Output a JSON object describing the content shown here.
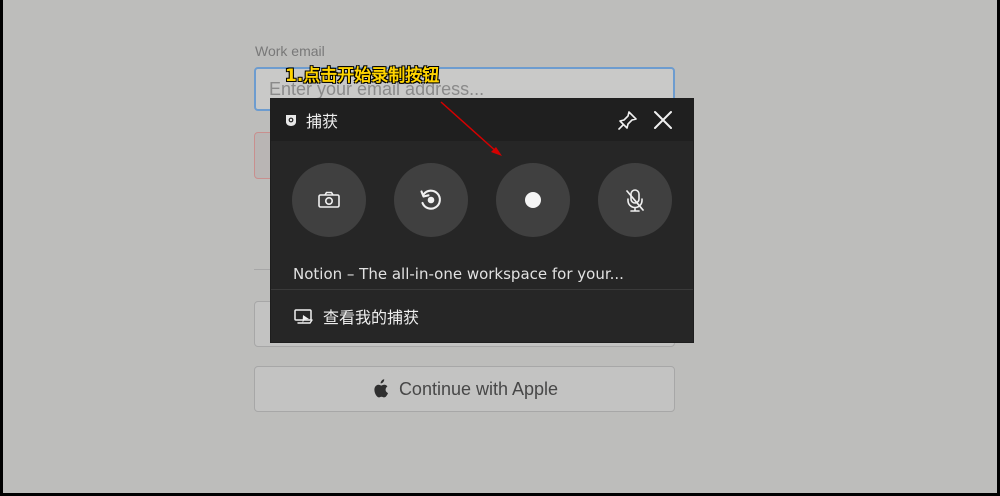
{
  "login": {
    "email_label": "Work email",
    "email_placeholder": "Enter your email address...",
    "apple_button_label": "Continue with Apple"
  },
  "annotation": {
    "text": "1.点击开始录制按钮",
    "color": "#ffd400"
  },
  "capture_widget": {
    "title": "捕获",
    "icons": {
      "title": "capture-icon",
      "pin": "pin-icon",
      "close": "close-icon",
      "screenshot": "camera-icon",
      "recent": "record-last-icon",
      "record": "record-icon",
      "microphone": "microphone-off-icon",
      "gallery": "gallery-icon"
    },
    "source_title": "Notion – The all-in-one workspace for your...",
    "gallery_label": "查看我的捕获"
  }
}
